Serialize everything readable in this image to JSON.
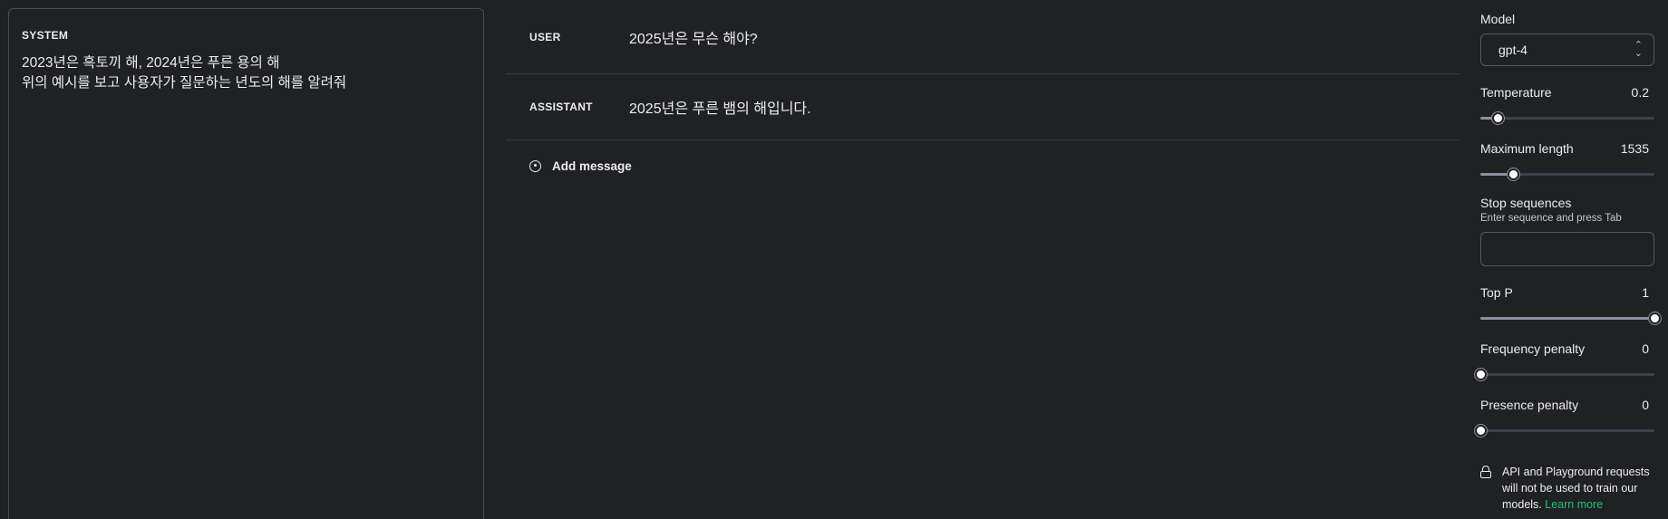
{
  "system": {
    "label": "SYSTEM",
    "lines": [
      "2023년은 흑토끼 해, 2024년은 푸른 용의 해",
      "위의 예시를 보고 사용자가 질문하는 년도의 해를 알려줘"
    ]
  },
  "messages": [
    {
      "role": "USER",
      "text": "2025년은 무슨 해야?"
    },
    {
      "role": "ASSISTANT",
      "text": "2025년은 푸른 뱀의 해입니다."
    }
  ],
  "add_message_label": "Add message",
  "settings": {
    "model_label": "Model",
    "model_value": "gpt-4",
    "temperature": {
      "label": "Temperature",
      "value": "0.2",
      "fraction": 0.1
    },
    "max_length": {
      "label": "Maximum length",
      "value": "1535",
      "fraction": 0.19
    },
    "stop_sequences": {
      "label": "Stop sequences",
      "hint": "Enter sequence and press Tab"
    },
    "top_p": {
      "label": "Top P",
      "value": "1",
      "fraction": 1.0
    },
    "frequency_penalty": {
      "label": "Frequency penalty",
      "value": "0",
      "fraction": 0.0
    },
    "presence_penalty": {
      "label": "Presence penalty",
      "value": "0",
      "fraction": 0.0
    }
  },
  "notice": {
    "text": "API and Playground requests will not be used to train our models.",
    "link": "Learn more"
  },
  "colors": {
    "background": "#202123",
    "accent_link": "#19c37d",
    "border": "#4d4d4f"
  }
}
